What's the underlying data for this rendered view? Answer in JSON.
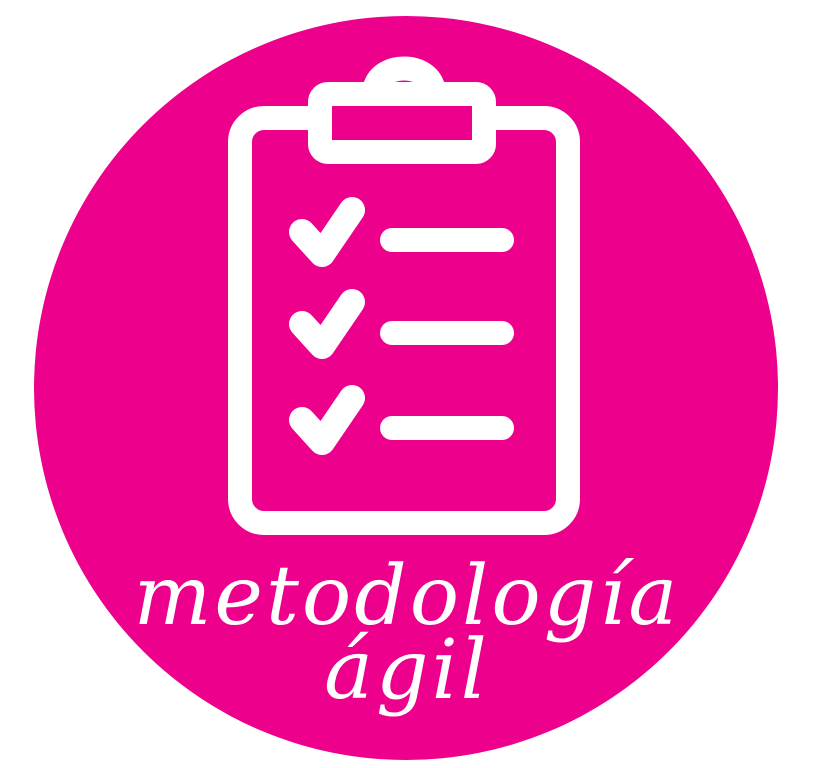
{
  "badge": {
    "background_color": "#ffffff",
    "circle_color": "#ec008c",
    "icon_color": "#ffffff",
    "icon": "clipboard-checklist-icon",
    "checklist_items": [
      {
        "checked": true
      },
      {
        "checked": true
      },
      {
        "checked": true
      }
    ],
    "caption": {
      "line1": "metodología",
      "line2": "ágil"
    }
  }
}
